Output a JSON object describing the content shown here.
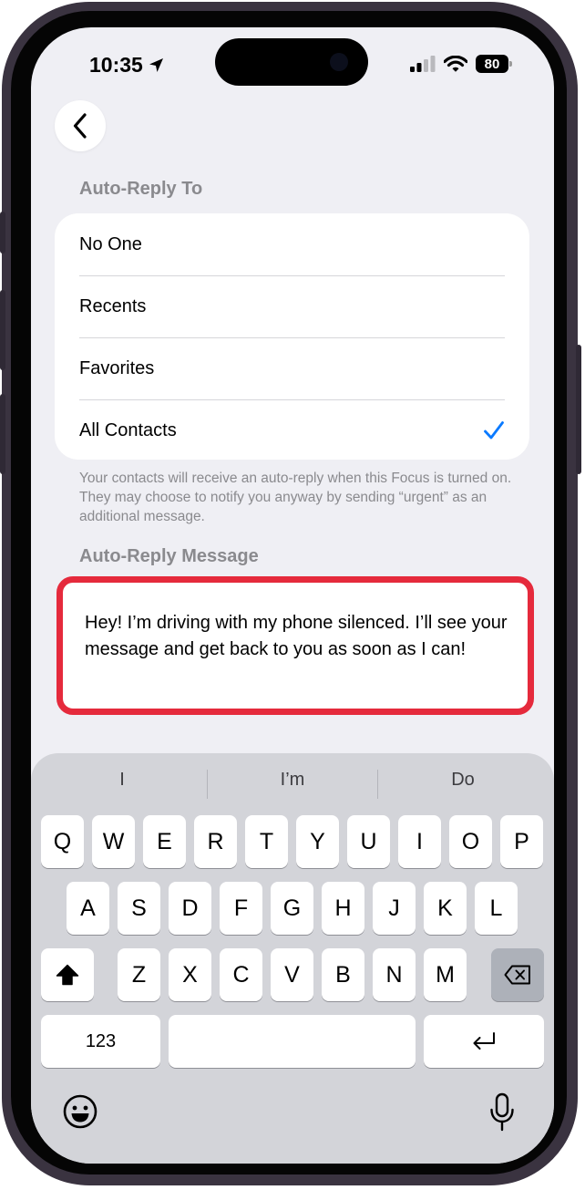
{
  "status_bar": {
    "time": "10:35",
    "battery": "80"
  },
  "nav": {
    "back_icon": "chevron-left-icon"
  },
  "auto_reply_to": {
    "header": "Auto-Reply To",
    "options": [
      {
        "label": "No One",
        "selected": false
      },
      {
        "label": "Recents",
        "selected": false
      },
      {
        "label": "Favorites",
        "selected": false
      },
      {
        "label": "All Contacts",
        "selected": true
      }
    ],
    "footnote": "Your contacts will receive an auto-reply when this Focus is turned on. They may choose to notify you anyway by sending “urgent” as an additional message."
  },
  "auto_reply_message": {
    "header": "Auto-Reply Message",
    "value": "Hey! I’m driving with my phone silenced. I’ll see your message and get back to you as soon as I can!"
  },
  "colors": {
    "accent": "#0a7aff",
    "highlight_border": "#e52a3c",
    "background": "#efeff4"
  },
  "keyboard": {
    "suggestions": [
      "I",
      "I’m",
      "Do"
    ],
    "row1": [
      "Q",
      "W",
      "E",
      "R",
      "T",
      "Y",
      "U",
      "I",
      "O",
      "P"
    ],
    "row2": [
      "A",
      "S",
      "D",
      "F",
      "G",
      "H",
      "J",
      "K",
      "L"
    ],
    "row3": [
      "Z",
      "X",
      "C",
      "V",
      "B",
      "N",
      "M"
    ],
    "numbers_label": "123",
    "space_label": ""
  }
}
